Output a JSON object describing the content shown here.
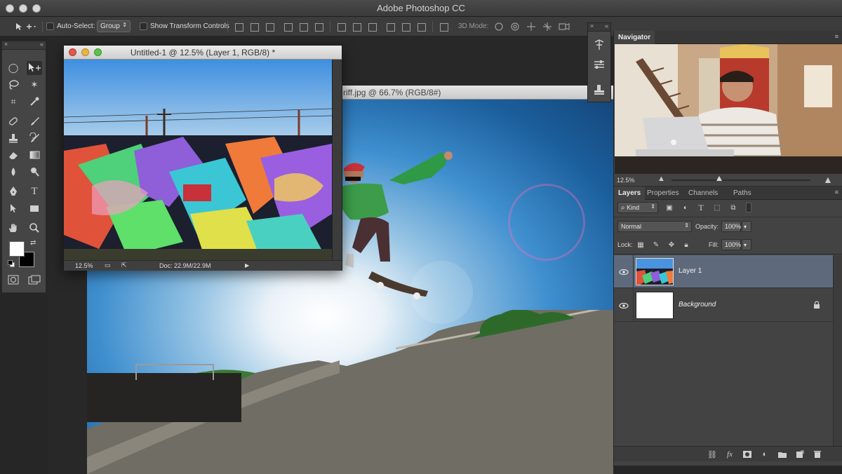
{
  "app": {
    "title": "Adobe Photoshop CC"
  },
  "options_bar": {
    "auto_select_label": "Auto-Select:",
    "auto_select_value": "Group",
    "transform_controls_label": "Show Transform Controls",
    "mode_3d_label": "3D Mode:"
  },
  "documents": {
    "front": {
      "title": "Untitled-1 @ 12.5% (Layer 1, RGB/8) *",
      "zoom": "12.5%",
      "doc_size": "Doc: 22.9M/22.9M"
    },
    "back": {
      "title": "riff.jpg @ 66.7% (RGB/8#)"
    }
  },
  "navigator": {
    "tab": "Navigator",
    "zoom": "12.5%"
  },
  "layers_panel": {
    "tabs": [
      "Layers",
      "Properties",
      "Channels",
      "Paths"
    ],
    "filter_kind": "Kind",
    "blend_mode": "Normal",
    "opacity_label": "Opacity:",
    "opacity_value": "100%",
    "lock_label": "Lock:",
    "fill_label": "Fill:",
    "fill_value": "100%",
    "layers": [
      {
        "name": "Layer 1",
        "selected": true,
        "visible": true
      },
      {
        "name": "Background",
        "selected": false,
        "visible": true,
        "locked": true
      }
    ]
  },
  "colors": {
    "foreground": "#ffffff",
    "background": "#000000",
    "selection": "#5e6a7c"
  }
}
